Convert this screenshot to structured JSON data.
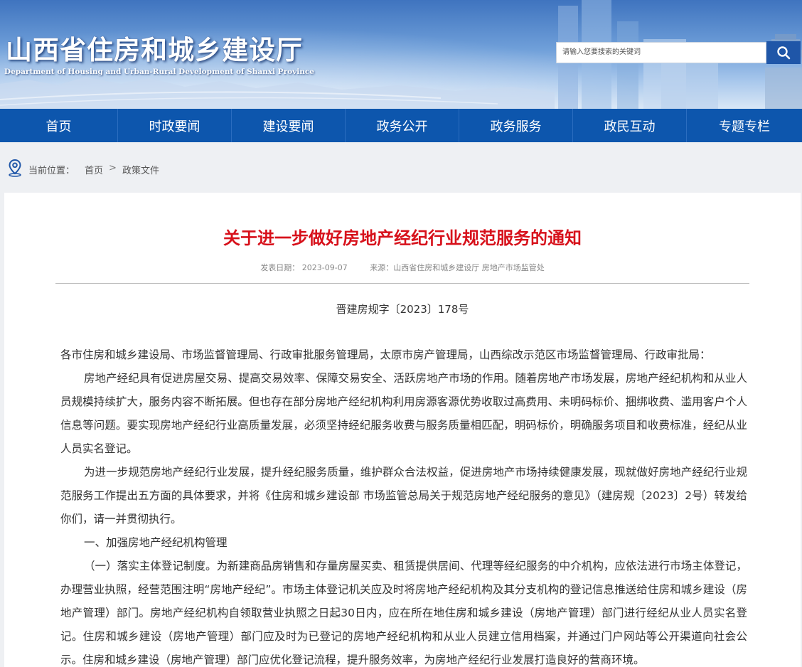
{
  "header": {
    "title": "山西省住房和城乡建设厅",
    "subtitle": "Department of Housing and Urban-Rural Development of Shanxi Province",
    "search": {
      "placeholder": "请输入您要搜索的关键词",
      "button_icon": "search-icon"
    },
    "colors": {
      "banner_top": "#3f74bf",
      "nav_bg": "#0d56ad",
      "search_button": "#1f56a8"
    }
  },
  "nav": {
    "items": [
      {
        "label": "首页"
      },
      {
        "label": "时政要闻"
      },
      {
        "label": "建设要闻"
      },
      {
        "label": "政务公开"
      },
      {
        "label": "政务服务"
      },
      {
        "label": "政民互动"
      },
      {
        "label": "专题专栏"
      }
    ]
  },
  "breadcrumb": {
    "icon": "location-pin-icon",
    "label": "当前位置：",
    "items": [
      {
        "label": "首页"
      },
      {
        "label": "政策文件"
      }
    ],
    "separator": ">"
  },
  "article": {
    "title": "关于进一步做好房地产经纪行业规范服务的通知",
    "title_color": "#d7111b",
    "meta": {
      "date": "发表日期： 2023-09-07",
      "source": "来源：山西省住房和城乡建设厅 房地产市场监管处"
    },
    "doc_number": "晋建房规字〔2023〕178号",
    "paragraphs": [
      {
        "text": "各市住房和城乡建设局、市场监督管理局、行政审批服务管理局，太原市房产管理局，山西综改示范区市场监督管理局、行政审批局：",
        "indent": false
      },
      {
        "text": "房地产经纪具有促进房屋交易、提高交易效率、保障交易安全、活跃房地产市场的作用。随着房地产市场发展，房地产经纪机构和从业人员规模持续扩大，服务内容不断拓展。但也存在部分房地产经纪机构利用房源客源优势收取过高费用、未明码标价、捆绑收费、滥用客户个人信息等问题。要实现房地产经纪行业高质量发展，必须坚持经纪服务收费与服务质量相匹配，明码标价，明确服务项目和收费标准，经纪从业人员实名登记。",
        "indent": true
      },
      {
        "text": "为进一步规范房地产经纪行业发展，提升经纪服务质量，维护群众合法权益，促进房地产市场持续健康发展，现就做好房地产经纪行业规范服务工作提出五方面的具体要求，并将《住房和城乡建设部 市场监管总局关于规范房地产经纪服务的意见》（建房规〔2023〕2号）转发给你们，请一并贯彻执行。",
        "indent": true
      },
      {
        "text": "一、加强房地产经纪机构管理",
        "indent": true
      },
      {
        "text": "（一）落实主体登记制度。为新建商品房销售和存量房屋买卖、租赁提供居间、代理等经纪服务的中介机构，应依法进行市场主体登记，办理营业执照，经营范围注明“房地产经纪”。市场主体登记机关应及时将房地产经纪机构及其分支机构的登记信息推送给住房和城乡建设（房地产管理）部门。房地产经纪机构自领取营业执照之日起30日内，应在所在地住房和城乡建设（房地产管理）部门进行经纪从业人员实名登记。住房和城乡建设（房地产管理）部门应及时为已登记的房地产经纪机构和从业人员建立信用档案，并通过门户网站等公开渠道向社会公示。住房和城乡建设（房地产管理）部门应优化登记流程，提升服务效率，为房地产经纪行业发展打造良好的营商环境。",
        "indent": true
      }
    ]
  }
}
